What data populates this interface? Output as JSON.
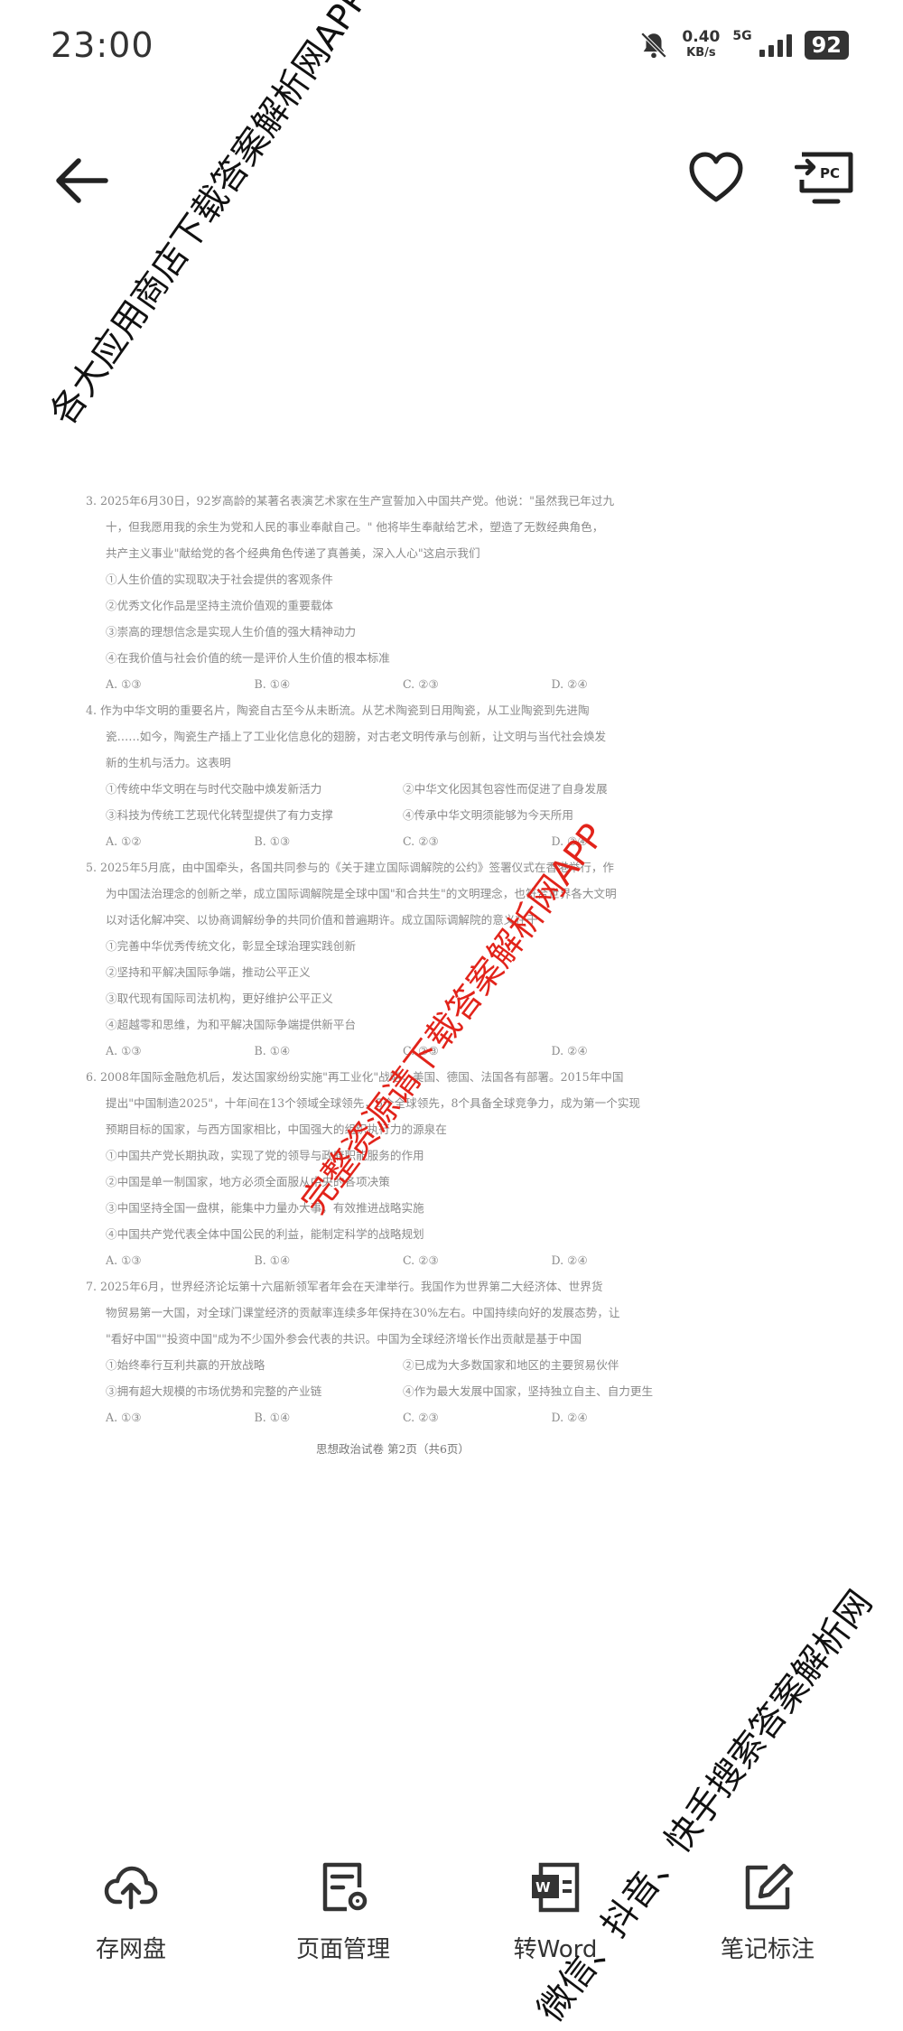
{
  "status_bar": {
    "time": "23:00",
    "speed_value": "0.40",
    "speed_unit": "KB/s",
    "network": "5G",
    "battery": "92"
  },
  "toolbar": {
    "back_icon": "arrow-left-icon",
    "favorite_icon": "heart-outline-icon",
    "pc_icon": "cast-to-pc-icon",
    "pc_label": "PC"
  },
  "watermarks": {
    "top": "各大应用商店下载答案解析网APP",
    "middle": "完整资源请下载答案解析网APP",
    "bottom": "微信、抖音、快手搜索答案解析网"
  },
  "document": {
    "lines": [
      "3. 2025年6月30日，92岁高龄的某著名表演艺术家在生产宣誓加入中国共产党。他说：\"虽然我已年过九",
      "十，但我愿用我的余生为党和人民的事业奉献自己。\" 他将毕生奉献给艺术，塑造了无数经典角色，",
      "共产主义事业\"献给党的各个经典角色传递了真善美，深入人心\"这启示我们",
      "①人生价值的实现取决于社会提供的客观条件",
      "②优秀文化作品是坚持主流价值观的重要载体",
      "③崇高的理想信念是实现人生价值的强大精神动力",
      "④在我价值与社会价值的统一是评价人生价值的根本标准"
    ],
    "q3_options": [
      "A. ①③",
      "B. ①④",
      "C. ②③",
      "D. ②④"
    ],
    "q4_lines": [
      "4. 作为中华文明的重要名片，陶瓷自古至今从未断流。从艺术陶瓷到日用陶瓷，从工业陶瓷到先进陶",
      "瓷……如今，陶瓷生产插上了工业化信息化的翅膀，对古老文明传承与创新，让文明与当代社会焕发",
      "新的生机与活力。这表明"
    ],
    "q4_pairs": [
      [
        "①传统中华文明在与时代交融中焕发新活力",
        "②中华文化因其包容性而促进了自身发展"
      ],
      [
        "③科技为传统工艺现代化转型提供了有力支撑",
        "④传承中华文明须能够为今天所用"
      ]
    ],
    "q4_options": [
      "A. ①②",
      "B. ①③",
      "C. ②③",
      "D. ③④"
    ],
    "q5_lines": [
      "5. 2025年5月底，由中国牵头，各国共同参与的《关于建立国际调解院的公约》签署仪式在香港举行，作",
      "为中国法治理念的创新之举，成立国际调解院是全球中国\"和合共生\"的文明理念，也符合世界各大文明",
      "以对话化解冲突、以协商调解纷争的共同价值和普遍期许。成立国际调解院的意义在于"
    ],
    "q5_items": [
      "①完善中华优秀传统文化，彰显全球治理实践创新",
      "②坚持和平解决国际争端，推动公平正义",
      "③取代现有国际司法机构，更好维护公平正义",
      "④超越零和思维，为和平解决国际争端提供新平台"
    ],
    "q5_options": [
      "A. ①③",
      "B. ①④",
      "C. ②③",
      "D. ②④"
    ],
    "q6_lines": [
      "6. 2008年国际金融危机后，发达国家纷纷实施\"再工业化\"战略，美国、德国、法国各有部署。2015年中国",
      "提出\"中国制造2025\"，十年间在13个领域全球领先，5个全球领先，8个具备全球竞争力，成为第一个实现",
      "预期目标的国家，与西方国家相比，中国强大的组织执行力的源泉在"
    ],
    "q6_items": [
      "①中国共产党长期执政，实现了党的领导与政府职能服务的作用",
      "②中国是单一制国家，地方必须全面服从中央的各项决策",
      "③中国坚持全国一盘棋，能集中力量办大事，有效推进战略实施",
      "④中国共产党代表全体中国公民的利益，能制定科学的战略规划"
    ],
    "q6_options": [
      "A. ①③",
      "B. ①④",
      "C. ②③",
      "D. ②④"
    ],
    "q7_lines": [
      "7. 2025年6月，世界经济论坛第十六届新领军者年会在天津举行。我国作为世界第二大经济体、世界货",
      "物贸易第一大国，对全球门课堂经济的贡献率连续多年保持在30%左右。中国持续向好的发展态势，让",
      "\"看好中国\"\"投资中国\"成为不少国外参会代表的共识。中国为全球经济增长作出贡献是基于中国"
    ],
    "q7_pairs": [
      [
        "①始终奉行互利共赢的开放战略",
        "②已成为大多数国家和地区的主要贸易伙伴"
      ],
      [
        "③拥有超大规模的市场优势和完整的产业链",
        "④作为最大发展中国家，坚持独立自主、自力更生"
      ]
    ],
    "q7_options": [
      "A. ①③",
      "B. ①④",
      "C. ②③",
      "D. ②④"
    ],
    "footer": "思想政治试卷 第2页（共6页）"
  },
  "bottom_bar": [
    {
      "icon": "cloud-upload-icon",
      "label": "存网盘"
    },
    {
      "icon": "page-manage-icon",
      "label": "页面管理"
    },
    {
      "icon": "to-word-icon",
      "label": "转Word"
    },
    {
      "icon": "edit-note-icon",
      "label": "笔记标注"
    }
  ]
}
